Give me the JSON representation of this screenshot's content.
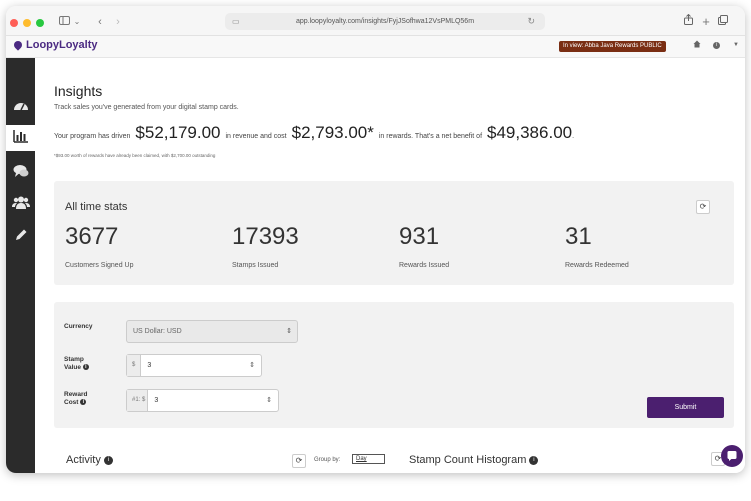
{
  "browser": {
    "url": "app.loopyloyalty.com/insights/FyjJSofhwa12VsPMLQ56m",
    "colors": {
      "close": "#ff5f57",
      "minimize": "#febc2e",
      "maximize": "#28c840"
    }
  },
  "app": {
    "logo_text": "LoopyLoyalty",
    "view_badge": "In view: Abba Java Rewards PUBLIC"
  },
  "sidebar": {
    "items": [
      {
        "icon": "dashboard-icon"
      },
      {
        "icon": "bar-chart-icon",
        "active": true
      },
      {
        "icon": "chat-icon"
      },
      {
        "icon": "users-icon"
      },
      {
        "icon": "pencil-icon"
      }
    ]
  },
  "insights": {
    "title": "Insights",
    "subtitle": "Track sales you've generated from your digital stamp cards.",
    "summary": {
      "prefix": "Your program has driven",
      "revenue": "$52,179.00",
      "middle": "in revenue and cost",
      "cost": "$2,793.00*",
      "suffix": "in rewards. That's a net benefit of",
      "net": "$49,386.00",
      "end": "."
    },
    "note": "*$93.00 worth of rewards have already been claimed, with $2,700.00 outstanding"
  },
  "stats": {
    "title": "All time stats",
    "items": [
      {
        "value": "3677",
        "label": "Customers Signed Up"
      },
      {
        "value": "17393",
        "label": "Stamps Issued"
      },
      {
        "value": "931",
        "label": "Rewards Issued"
      },
      {
        "value": "31",
        "label": "Rewards Redeemed"
      }
    ]
  },
  "form": {
    "currency_label": "Currency",
    "currency_value": "US Dollar: USD",
    "stamp_value_label_1": "Stamp",
    "stamp_value_label_2": "Value",
    "stamp_prefix": "$",
    "stamp_value": "3",
    "reward_cost_label_1": "Reward",
    "reward_cost_label_2": "Cost",
    "reward_prefix_1": "#1:",
    "reward_prefix_2": "$",
    "reward_cost": "3",
    "submit": "Submit",
    "submit_color": "#4b1f6f"
  },
  "activity": {
    "title": "Activity",
    "group_by_label": "Group by:",
    "group_by_value": "Day"
  },
  "histogram": {
    "title": "Stamp Count Histogram"
  }
}
